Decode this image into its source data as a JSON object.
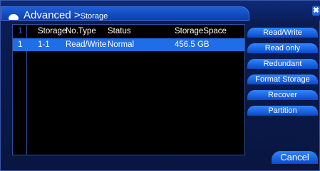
{
  "window": {
    "title_main": "Advanced >",
    "title_sub": "Storage",
    "close_glyph": "✖"
  },
  "table": {
    "headers": {
      "index": "1",
      "storage": "Storage",
      "type": "No.Type",
      "status": "Status",
      "space": "StorageSpace"
    },
    "rows": [
      {
        "index": "1",
        "storage": "1-1",
        "type": "Read/Write",
        "status": "Normal",
        "space": "456.5 GB"
      }
    ]
  },
  "buttons": {
    "read_write": "Read/Write",
    "read_only": "Read only",
    "redundant": "Redundant",
    "format_storage": "Format Storage",
    "recover": "Recover",
    "partition": "Partition",
    "cancel": "Cancel"
  },
  "colors": {
    "accent": "#1e6ee8",
    "button": "#2f86ff"
  }
}
